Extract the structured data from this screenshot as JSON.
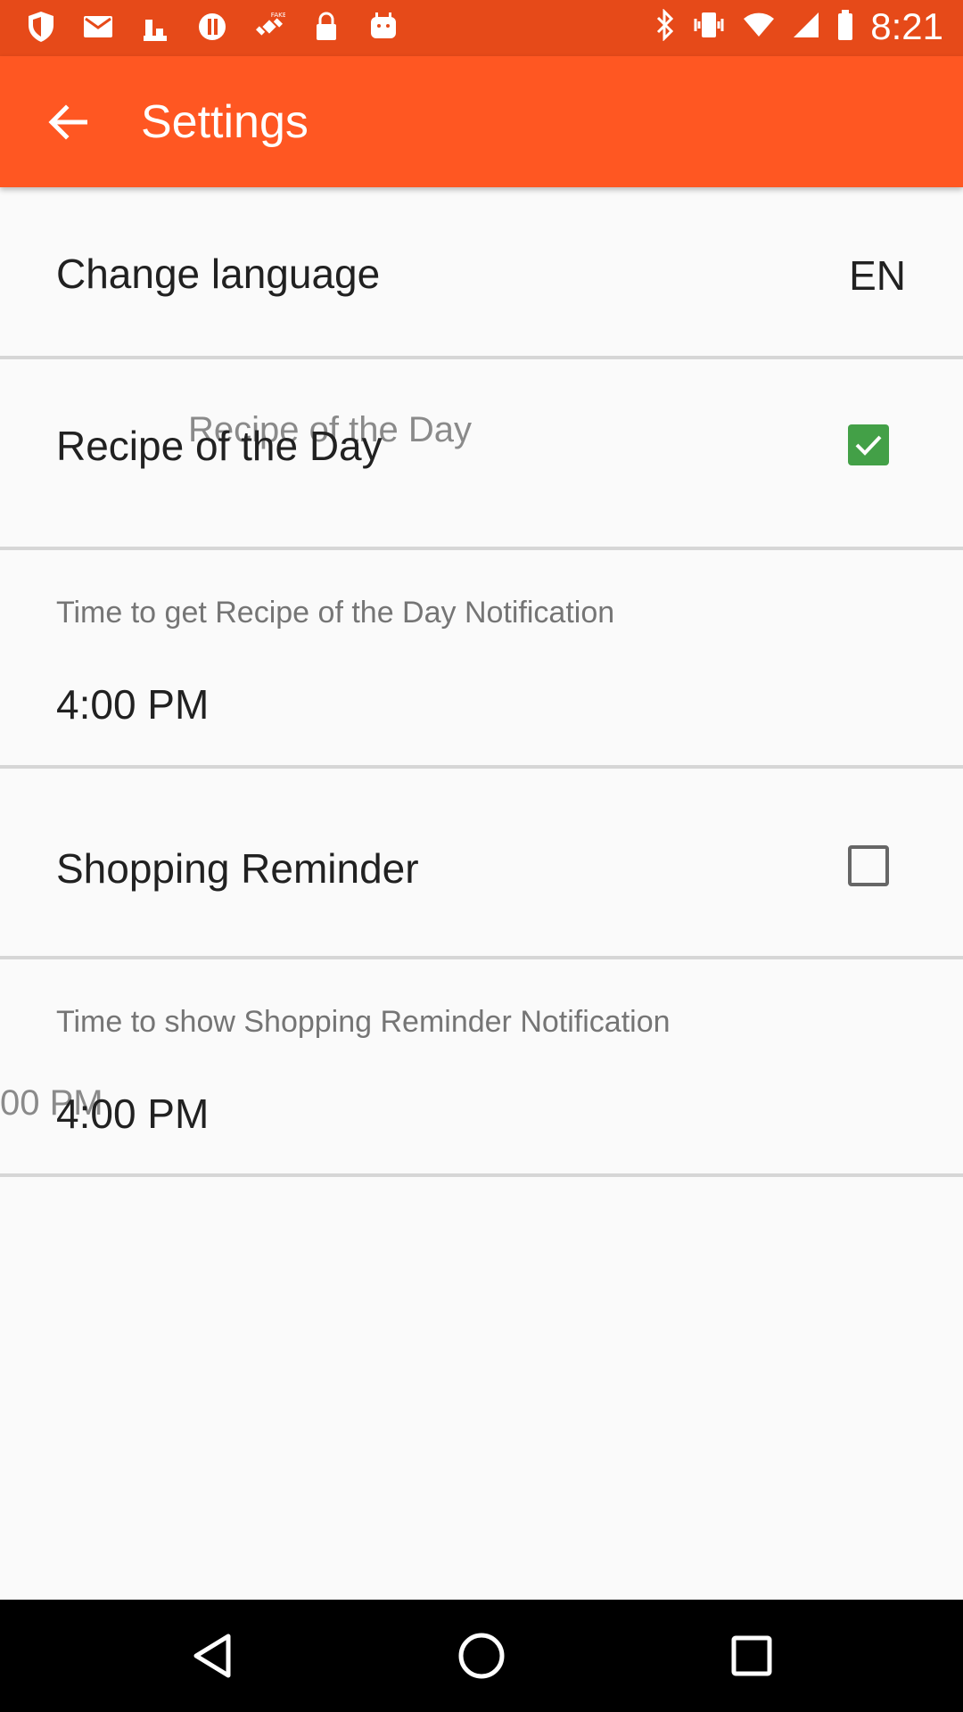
{
  "status_bar": {
    "time": "8:21",
    "icons": [
      "shield-icon",
      "mail-icon",
      "cocktail-icon",
      "alert-circle-icon",
      "fake-gps-icon",
      "lock-icon",
      "android-icon",
      "bluetooth-icon",
      "vibrate-icon",
      "wifi-icon",
      "signal-icon",
      "battery-icon"
    ]
  },
  "app_bar": {
    "title": "Settings",
    "back_icon": "arrow-back-icon"
  },
  "settings": {
    "language": {
      "label": "Change language",
      "value": "EN"
    },
    "recipe_of_day": {
      "label": "Recipe of the Day",
      "ghost_label": "Recipe of the Day",
      "checked": true
    },
    "recipe_time": {
      "label": "Time to get Recipe of the Day Notification",
      "value": "4:00 PM"
    },
    "shopping": {
      "label": "Shopping Reminder",
      "checked": false
    },
    "shopping_time": {
      "label": "Time to show Shopping Reminder Notification",
      "value": "4:00 PM",
      "ghost_value": "00 PM"
    }
  },
  "nav_bar": {
    "back_icon": "nav-back-triangle-icon",
    "home_icon": "nav-home-circle-icon",
    "recents_icon": "nav-recents-square-icon"
  },
  "colors": {
    "status_bar": "#e64a19",
    "app_bar": "#ff5722",
    "checkbox_checked": "#43a047"
  }
}
